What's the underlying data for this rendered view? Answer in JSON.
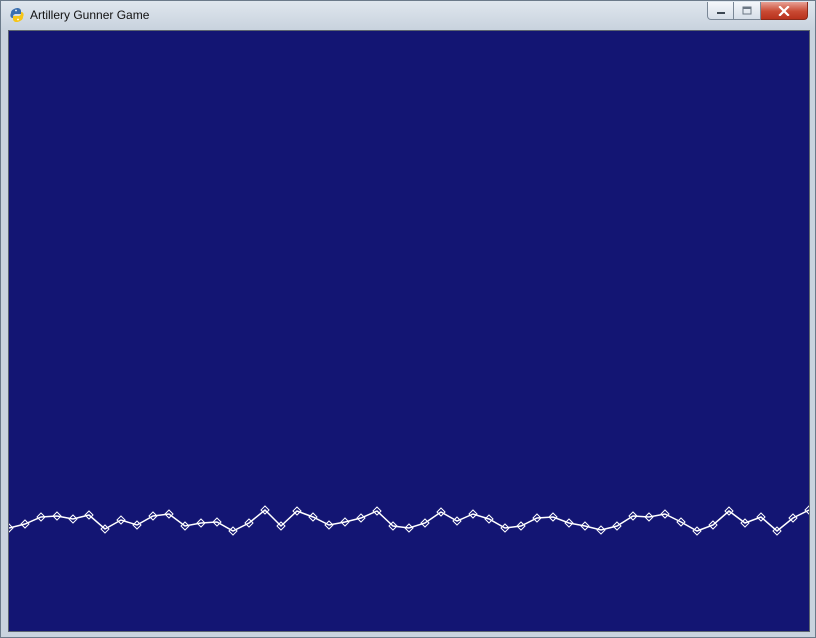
{
  "window": {
    "title": "Artillery Gunner Game",
    "icon": "python-snake-icon",
    "controls": [
      "minimize",
      "maximize",
      "close"
    ]
  },
  "game": {
    "background_color": "#131573",
    "terrain_color": "#ffffff",
    "terrain_heights": [
      527,
      523,
      516,
      515,
      518,
      514,
      528,
      519,
      524,
      515,
      513,
      525,
      522,
      521,
      530,
      522,
      509,
      525,
      510,
      516,
      524,
      521,
      517,
      510,
      525,
      527,
      522,
      511,
      520,
      513,
      518,
      527,
      525,
      517,
      516,
      522,
      525,
      529,
      525,
      515,
      516,
      513,
      521,
      530,
      524,
      510,
      522,
      516,
      530,
      517,
      509
    ]
  }
}
